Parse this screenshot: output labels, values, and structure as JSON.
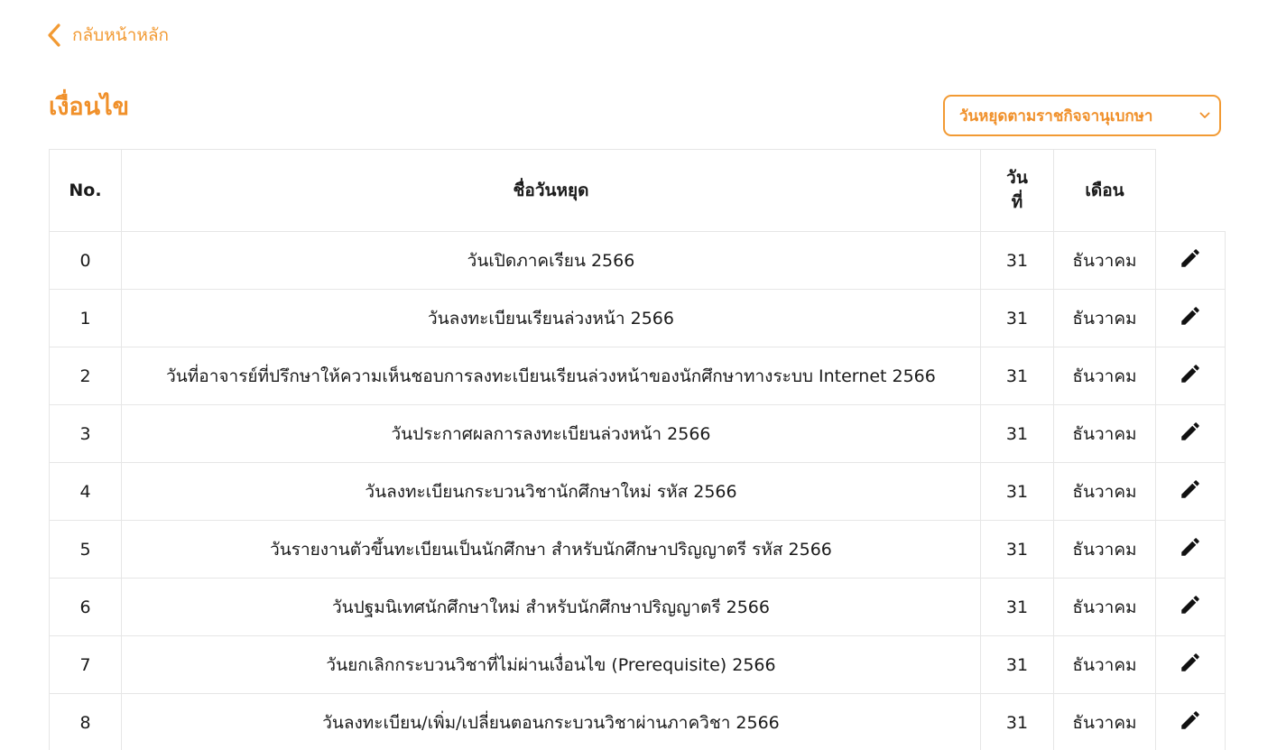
{
  "nav": {
    "back_label": "กลับหน้าหลัก"
  },
  "page": {
    "title": "เงื่อนไข"
  },
  "filter": {
    "selected": "วันหยุดตามราชกิจจานุเบกษา"
  },
  "table": {
    "headers": {
      "no": "No.",
      "name": "ชื่อวันหยุด",
      "day_line1": "วัน",
      "day_line2": "ที่",
      "month": "เดือน"
    },
    "rows": [
      {
        "no": "0",
        "name": "วันเปิดภาคเรียน 2566",
        "day": "31",
        "month": "ธันวาคม"
      },
      {
        "no": "1",
        "name": "วันลงทะเบียนเรียนล่วงหน้า 2566",
        "day": "31",
        "month": "ธันวาคม"
      },
      {
        "no": "2",
        "name": "วันที่อาจารย์ที่ปรึกษาให้ความเห็นชอบการลงทะเบียนเรียนล่วงหน้าของนักศึกษาทางระบบ Internet 2566",
        "day": "31",
        "month": "ธันวาคม"
      },
      {
        "no": "3",
        "name": "วันประกาศผลการลงทะเบียนล่วงหน้า 2566",
        "day": "31",
        "month": "ธันวาคม"
      },
      {
        "no": "4",
        "name": "วันลงทะเบียนกระบวนวิชานักศึกษาใหม่ รหัส 2566",
        "day": "31",
        "month": "ธันวาคม"
      },
      {
        "no": "5",
        "name": "วันรายงานตัวขึ้นทะเบียนเป็นนักศึกษา สำหรับนักศึกษาปริญญาตรี รหัส 2566",
        "day": "31",
        "month": "ธันวาคม"
      },
      {
        "no": "6",
        "name": "วันปฐมนิเทศนักศึกษาใหม่ สำหรับนักศึกษาปริญญาตรี 2566",
        "day": "31",
        "month": "ธันวาคม"
      },
      {
        "no": "7",
        "name": "วันยกเลิกกระบวนวิชาที่ไม่ผ่านเงื่อนไข (Prerequisite) 2566",
        "day": "31",
        "month": "ธันวาคม"
      },
      {
        "no": "8",
        "name": "วันลงทะเบียน/เพิ่ม/เปลี่ยนตอนกระบวนวิชาผ่านภาควิชา 2566",
        "day": "31",
        "month": "ธันวาคม"
      }
    ]
  },
  "icons": {
    "back": "chevron-left-icon",
    "dropdown": "chevron-down-icon",
    "edit": "pencil-icon"
  },
  "colors": {
    "accent": "#f0902a",
    "border": "#e6e6e6",
    "text": "#1a1a1a"
  }
}
